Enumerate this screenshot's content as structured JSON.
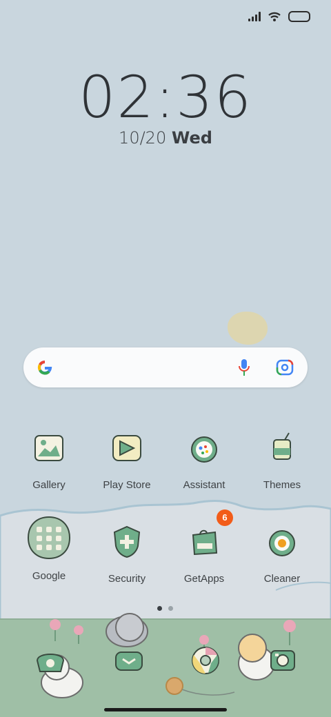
{
  "status_bar": {
    "signal_icon": "cellular-signal-icon",
    "wifi_icon": "wifi-icon",
    "battery_icon": "battery-icon"
  },
  "clock": {
    "time": "02:36",
    "date": "10/20",
    "weekday": "Wed"
  },
  "search_bar": {
    "logo_icon": "google-g-icon",
    "voice_icon": "microphone-icon",
    "lens_icon": "google-lens-icon"
  },
  "apps_row1": [
    {
      "label": "Gallery",
      "icon": "gallery-icon"
    },
    {
      "label": "Play Store",
      "icon": "play-store-icon"
    },
    {
      "label": "Assistant",
      "icon": "assistant-icon"
    },
    {
      "label": "Themes",
      "icon": "themes-icon"
    }
  ],
  "apps_row2": [
    {
      "label": "Google",
      "icon": "google-folder-icon"
    },
    {
      "label": "Security",
      "icon": "security-icon"
    },
    {
      "label": "GetApps",
      "icon": "getapps-icon",
      "badge": "6"
    },
    {
      "label": "Cleaner",
      "icon": "cleaner-icon"
    }
  ],
  "dock": [
    {
      "icon": "phone-icon"
    },
    {
      "icon": "messages-icon"
    },
    {
      "icon": "chrome-icon"
    },
    {
      "icon": "camera-icon"
    }
  ],
  "page_indicator": {
    "pages": 2,
    "current": 1
  },
  "colors": {
    "sky": "#c9d6de",
    "hill": "#d9dfe4",
    "grass": "#9fbfa6",
    "icon_green": "#6fae8a",
    "badge": "#f25c19"
  }
}
